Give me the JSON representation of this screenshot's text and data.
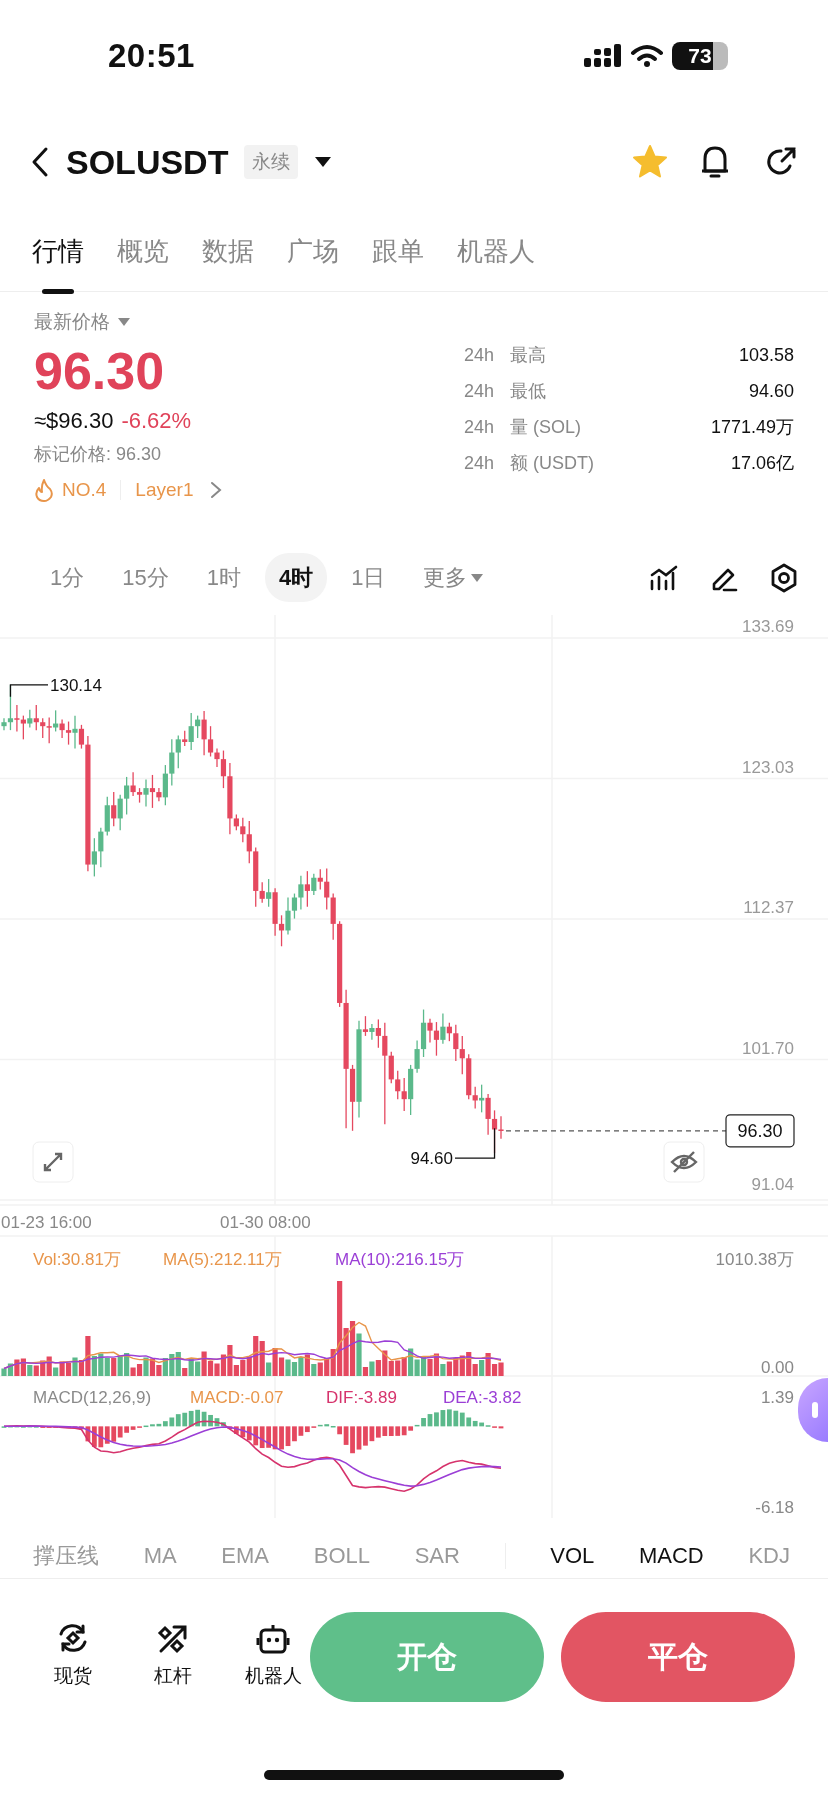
{
  "status_bar": {
    "time": "20:51",
    "battery": "73"
  },
  "header": {
    "symbol": "SOLUSDT",
    "badge": "永续",
    "favorite": true
  },
  "tabs": [
    {
      "label": "行情",
      "selected": true
    },
    {
      "label": "概览",
      "selected": false
    },
    {
      "label": "数据",
      "selected": false
    },
    {
      "label": "广场",
      "selected": false
    },
    {
      "label": "跟单",
      "selected": false
    },
    {
      "label": "机器人",
      "selected": false
    }
  ],
  "price_info": {
    "title": "最新价格",
    "last_price": "96.30",
    "usd_price": "≈$96.30",
    "change": "-6.62%",
    "mark_price": "标记价格: 96.30",
    "rank": "NO.4",
    "tag": "Layer1"
  },
  "stats": [
    {
      "prefix": "24h",
      "label": "最高",
      "value": "103.58"
    },
    {
      "prefix": "24h",
      "label": "最低",
      "value": "94.60"
    },
    {
      "prefix": "24h",
      "label": "量 (SOL)",
      "value": "1771.49万"
    },
    {
      "prefix": "24h",
      "label": "额 (USDT)",
      "value": "17.06亿"
    }
  ],
  "timeframes": [
    {
      "label": "1分",
      "selected": false
    },
    {
      "label": "15分",
      "selected": false
    },
    {
      "label": "1时",
      "selected": false
    },
    {
      "label": "4时",
      "selected": true
    },
    {
      "label": "1日",
      "selected": false
    }
  ],
  "more_label": "更多",
  "chart": {
    "y_labels": [
      "133.69",
      "123.03",
      "112.37",
      "101.70",
      "91.04"
    ],
    "high_marker": "130.14",
    "low_marker": "94.60",
    "current_price": "96.30",
    "x_labels": [
      "01-23 16:00",
      "01-30 08:00"
    ]
  },
  "volume": {
    "legend": [
      {
        "text": "Vol:30.81万",
        "color": "#e8954a"
      },
      {
        "text": "MA(5):212.11万",
        "color": "#e8954a"
      },
      {
        "text": "MA(10):216.15万",
        "color": "#9b3fd6"
      }
    ],
    "y_labels": [
      "1010.38万",
      "0.00"
    ]
  },
  "macd": {
    "legend": [
      {
        "text": "MACD(12,26,9)",
        "color": "#8a8a8a"
      },
      {
        "text": "MACD:-0.07",
        "color": "#e8954a"
      },
      {
        "text": "DIF:-3.89",
        "color": "#d6336c"
      },
      {
        "text": "DEA:-3.82",
        "color": "#9b3fd6"
      }
    ],
    "y_labels": [
      "1.39",
      "-6.18"
    ]
  },
  "main_indicators": [
    {
      "label": "撑压线",
      "selected": false
    },
    {
      "label": "MA",
      "selected": false
    },
    {
      "label": "EMA",
      "selected": false
    },
    {
      "label": "BOLL",
      "selected": false
    },
    {
      "label": "SAR",
      "selected": false
    }
  ],
  "sub_indicators": [
    {
      "label": "VOL",
      "selected": true
    },
    {
      "label": "MACD",
      "selected": true
    },
    {
      "label": "KDJ",
      "selected": false
    }
  ],
  "bottom_nav": [
    {
      "label": "现货",
      "kind": "spot"
    },
    {
      "label": "杠杆",
      "kind": "margin"
    },
    {
      "label": "机器人",
      "kind": "robot"
    }
  ],
  "actions": [
    {
      "label": "开仓",
      "kind": "open"
    },
    {
      "label": "平仓",
      "kind": "close"
    }
  ]
}
